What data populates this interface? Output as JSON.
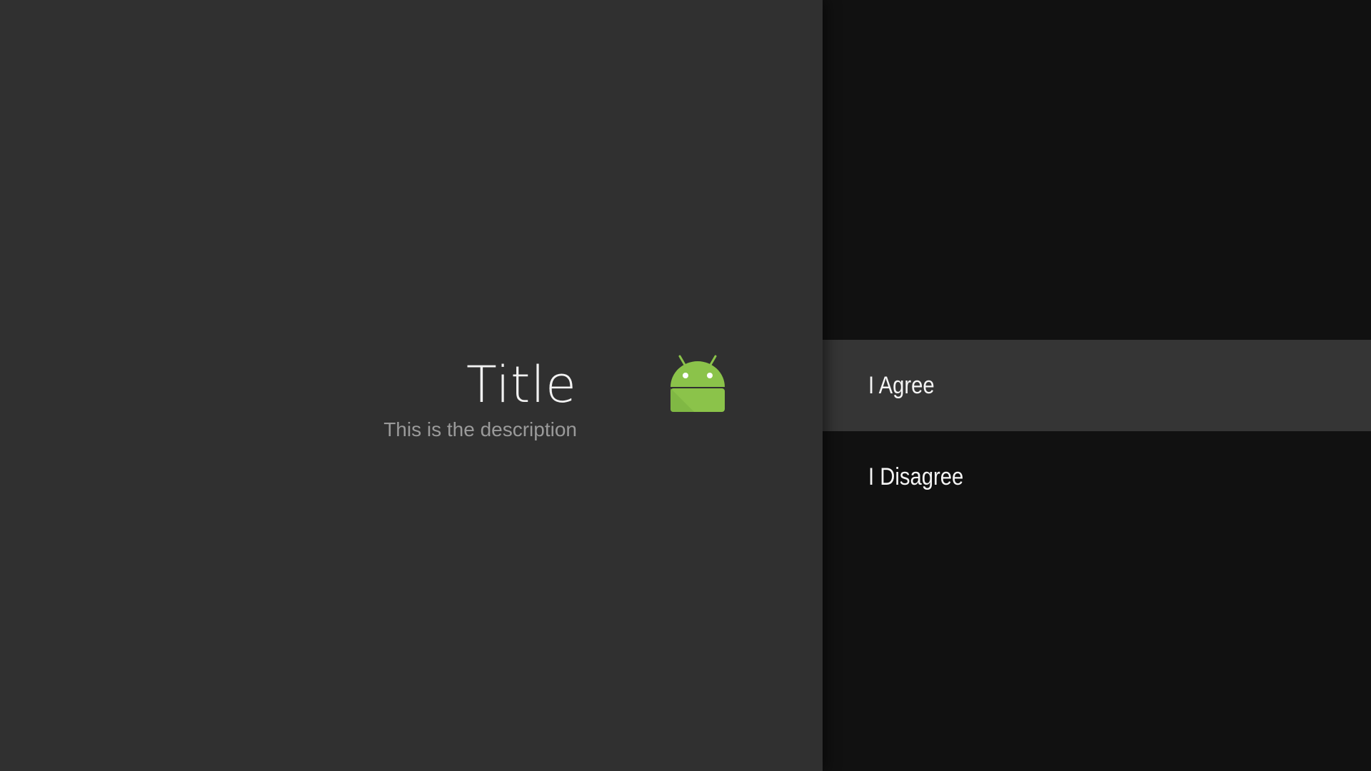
{
  "guidance": {
    "title": "Title",
    "description": "This is the description",
    "icon": "android-icon",
    "icon_color": "#8bc34a"
  },
  "actions": {
    "items": [
      {
        "label": "I Agree",
        "focused": true
      },
      {
        "label": "I Disagree",
        "focused": false
      }
    ]
  },
  "colors": {
    "guidance_background": "#303030",
    "actions_background": "#111111",
    "focused_action_background": "#353535"
  }
}
